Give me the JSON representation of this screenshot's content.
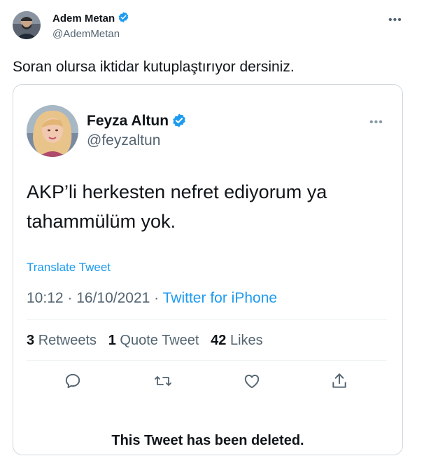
{
  "outer_tweet": {
    "author_name": "Adem Metan",
    "author_handle": "@AdemMetan",
    "text": "Soran olursa iktidar kutuplaştırıyor dersiniz.",
    "more_icon": "more-dots-icon"
  },
  "quoted_tweet": {
    "author_name": "Feyza Altun",
    "author_handle": "@feyzaltun",
    "text_line1": "AKP’li herkesten nefret ediyorum ya",
    "text_line2": "tahammülüm yok.",
    "translate_label": "Translate Tweet",
    "time": "10:12",
    "date": "16/10/2021",
    "separator": " · ",
    "source": "Twitter for iPhone",
    "stats": {
      "retweets_count": "3",
      "retweets_label": "Retweets",
      "quotes_count": "1",
      "quotes_label": "Quote Tweet",
      "likes_count": "42",
      "likes_label": "Likes"
    },
    "deleted_notice": "This Tweet has been deleted."
  },
  "colors": {
    "accent": "#1d9bf0",
    "muted": "#536471",
    "border": "#cfd9de",
    "verified": "#1d9bf0"
  }
}
